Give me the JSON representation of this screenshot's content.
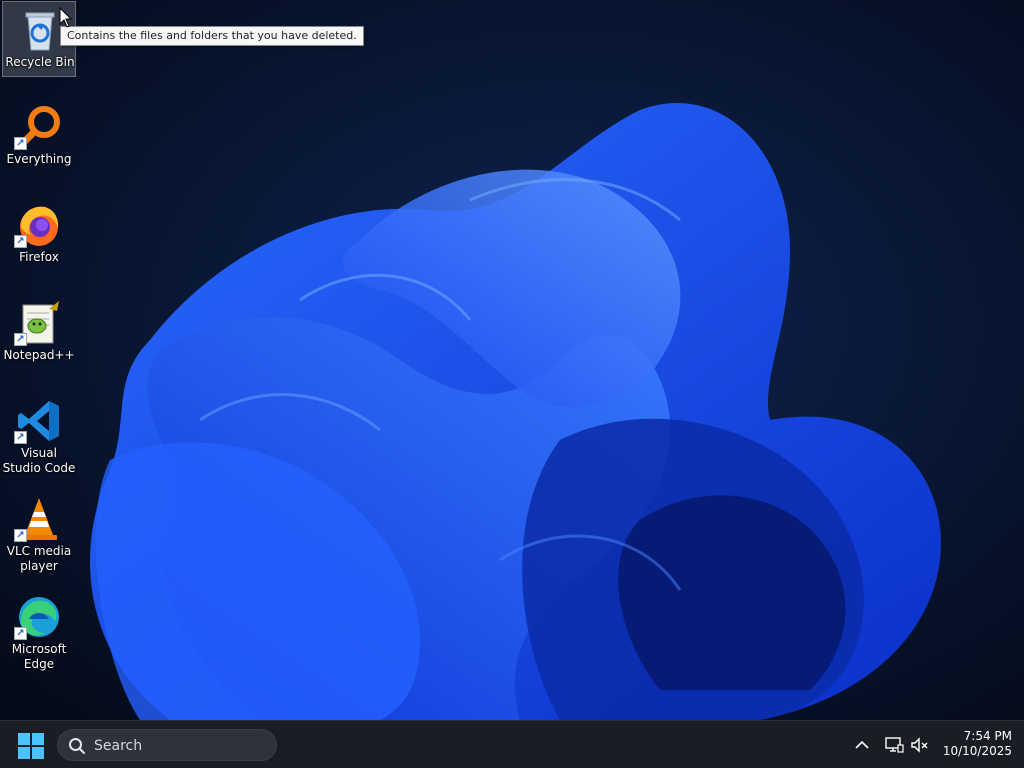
{
  "desktop": {
    "icons": [
      {
        "label": "Recycle Bin",
        "icon": "recycle-bin-icon"
      },
      {
        "label": "Everything",
        "icon": "everything-search-icon"
      },
      {
        "label": "Firefox",
        "icon": "firefox-icon"
      },
      {
        "label": "Notepad++",
        "icon": "notepad-plus-plus-icon"
      },
      {
        "label": "Visual Studio Code",
        "icon": "vscode-icon"
      },
      {
        "label": "VLC media player",
        "icon": "vlc-icon"
      },
      {
        "label": "Microsoft Edge",
        "icon": "edge-icon"
      }
    ],
    "tooltip": "Contains the files and folders that you have deleted."
  },
  "taskbar": {
    "search_placeholder": "Search",
    "clock": {
      "time": "7:54 PM",
      "date": "10/10/2025"
    }
  },
  "colors": {
    "accent": "#1f5cff",
    "taskbar": "#1b1d24"
  }
}
